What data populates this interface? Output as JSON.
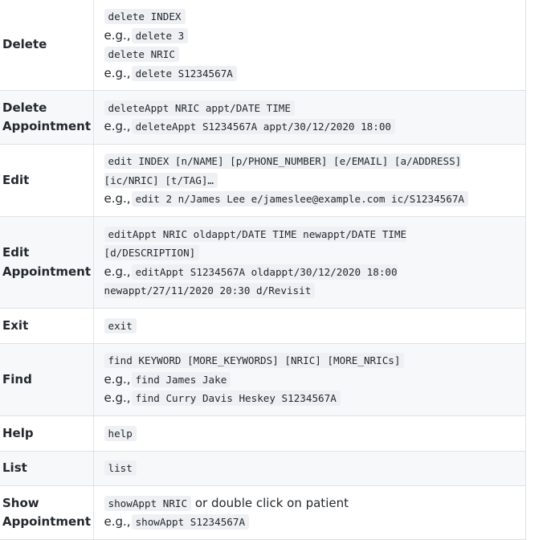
{
  "rows": [
    {
      "command": "Delete",
      "lines": [
        {
          "prefix": "",
          "code": "delete INDEX",
          "suffix": ""
        },
        {
          "prefix": "e.g.,",
          "code": "delete 3",
          "suffix": ""
        },
        {
          "prefix": "",
          "code": "delete NRIC",
          "suffix": ""
        },
        {
          "prefix": "e.g.,",
          "code": "delete S1234567A",
          "suffix": ""
        }
      ]
    },
    {
      "command_line1": "Delete",
      "command_line2": "Appointment",
      "lines": [
        {
          "prefix": "",
          "code": "deleteAppt NRIC appt/DATE TIME",
          "suffix": ""
        },
        {
          "prefix": "e.g.,",
          "code": "deleteAppt S1234567A appt/30/12/2020 18:00",
          "suffix": ""
        }
      ]
    },
    {
      "command": "Edit",
      "format_code": "edit INDEX [n/NAME] [p/PHONE_NUMBER] [e/EMAIL] [a/ADDRESS] [ic/NRIC] [t/TAG]…",
      "example_prefix": "e.g.,",
      "example_code": "edit 2 n/James Lee e/jameslee@example.com ic/S1234567A"
    },
    {
      "command_line1": "Edit",
      "command_line2": "Appointment",
      "format_code": "editAppt NRIC oldappt/DATE TIME newappt/DATE TIME [d/DESCRIPTION]",
      "example_prefix": "e.g.,",
      "example_code": "editAppt S1234567A oldappt/30/12/2020 18:00 newappt/27/11/2020 20:30 d/Revisit"
    },
    {
      "command": "Exit",
      "lines": [
        {
          "prefix": "",
          "code": "exit",
          "suffix": ""
        }
      ]
    },
    {
      "command": "Find",
      "lines": [
        {
          "prefix": "",
          "code": "find KEYWORD [MORE_KEYWORDS] [NRIC] [MORE_NRICs]",
          "suffix": ""
        },
        {
          "prefix": "e.g.,",
          "code": "find James Jake",
          "suffix": ""
        },
        {
          "prefix": "e.g.,",
          "code": "find Curry Davis Heskey S1234567A",
          "suffix": ""
        }
      ]
    },
    {
      "command": "Help",
      "lines": [
        {
          "prefix": "",
          "code": "help",
          "suffix": ""
        }
      ]
    },
    {
      "command": "List",
      "lines": [
        {
          "prefix": "",
          "code": "list",
          "suffix": ""
        }
      ]
    },
    {
      "command_line1": "Show",
      "command_line2": "Appointment",
      "lines": [
        {
          "prefix": "",
          "code": "showAppt NRIC",
          "suffix": "or double click on patient"
        },
        {
          "prefix": "e.g.,",
          "code": "showAppt S1234567A",
          "suffix": ""
        }
      ]
    }
  ]
}
